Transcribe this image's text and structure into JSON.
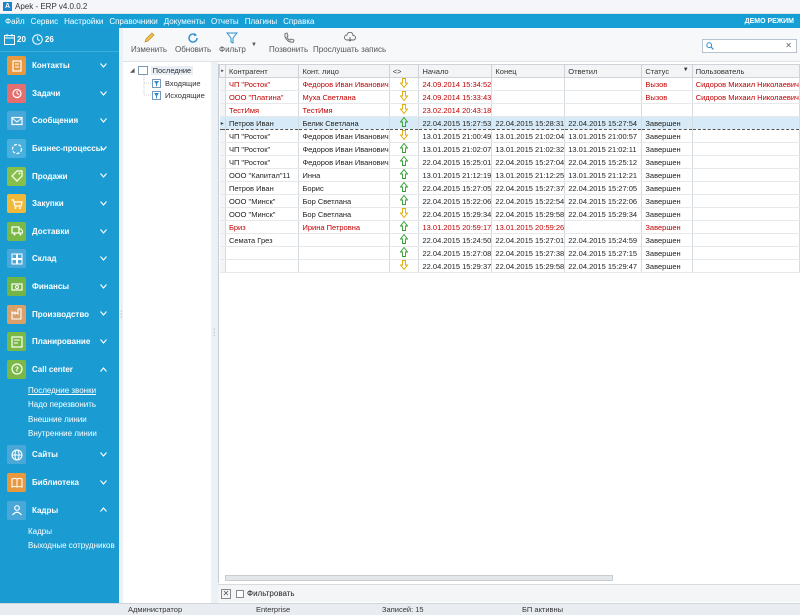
{
  "window": {
    "title": "Apek - ERP v4.0.0.2",
    "app_icon": "A"
  },
  "menu": {
    "items": [
      "Файл",
      "Сервис",
      "Настройки",
      "Справочники",
      "Документы",
      "Отчеты",
      "Плагины",
      "Справка"
    ],
    "demo_label": "ДЕМО РЕЖИМ"
  },
  "sidebar": {
    "calendar_value": "20",
    "clock_value": "26",
    "nav": [
      {
        "label": "Контакты",
        "icon": "contacts-icon",
        "color": "#e8983f",
        "expanded": false
      },
      {
        "label": "Задачи",
        "icon": "alarm-clock-icon",
        "color": "#e56f6f",
        "expanded": false
      },
      {
        "label": "Сообщения",
        "icon": "envelope-icon",
        "color": "#4aa8d8",
        "expanded": false
      },
      {
        "label": "Бизнес-процессы",
        "icon": "process-icon",
        "color": "#49b0de",
        "expanded": false
      },
      {
        "label": "Продажи",
        "icon": "tag-icon",
        "color": "#86c04a",
        "expanded": false
      },
      {
        "label": "Закупки",
        "icon": "cart-icon",
        "color": "#f0b93a",
        "expanded": false
      },
      {
        "label": "Доставки",
        "icon": "truck-icon",
        "color": "#7bb947",
        "expanded": false
      },
      {
        "label": "Склад",
        "icon": "warehouse-icon",
        "color": "#4aa8d8",
        "expanded": false
      },
      {
        "label": "Финансы",
        "icon": "money-icon",
        "color": "#73b545",
        "expanded": false
      },
      {
        "label": "Производство",
        "icon": "factory-icon",
        "color": "#d9a06a",
        "expanded": false
      },
      {
        "label": "Планирование",
        "icon": "planning-icon",
        "color": "#7bb947",
        "expanded": false
      },
      {
        "label": "Call center",
        "icon": "question-icon",
        "color": "#7bb947",
        "expanded": true,
        "subitems": [
          "Последние звонки",
          "Надо перезвонить",
          "Внешние линии",
          "Внутренние линии"
        ]
      },
      {
        "label": "Сайты",
        "icon": "globe-icon",
        "color": "#4aa8d8",
        "expanded": false
      },
      {
        "label": "Библиотека",
        "icon": "book-icon",
        "color": "#e8983f",
        "expanded": false
      },
      {
        "label": "Кадры",
        "icon": "person-icon",
        "color": "#4aa8d8",
        "expanded": true,
        "subitems": [
          "Кадры",
          "Выходные сотрудников"
        ]
      }
    ]
  },
  "toolbar": {
    "edit": "Изменить",
    "refresh": "Обновить",
    "filter": "Фильтр",
    "call": "Позвонить",
    "listen": "Прослушать запись",
    "search_placeholder": ""
  },
  "tree": {
    "root": "Последние",
    "children": [
      "Входящие",
      "Исходящие"
    ]
  },
  "grid": {
    "columns": [
      "Контрагент",
      "Конт. лицо",
      "<>",
      "Начало",
      "Конец",
      "Ответил",
      "Статус",
      "Пользователь"
    ],
    "rows": [
      {
        "contractor": "ЧП \"Росток\"",
        "contact": "Федоров Иван Иванович",
        "dir": "in",
        "start": "24.09.2014 15:34:52",
        "end": "",
        "answered": "",
        "status": "Вызов",
        "user": "Сидоров Михаил Николаевич",
        "red": true,
        "selected": false
      },
      {
        "contractor": "ООО \"Платина\"",
        "contact": "Муха Светлана",
        "dir": "in",
        "start": "24.09.2014 15:33:43",
        "end": "",
        "answered": "",
        "status": "Вызов",
        "user": "Сидоров Михаил Николаевич",
        "red": true,
        "selected": false
      },
      {
        "contractor": "ТестИмя",
        "contact": "ТестИмя",
        "dir": "in",
        "start": "23.02.2014 20:43:18",
        "end": "",
        "answered": "",
        "status": "",
        "user": "",
        "red": true,
        "selected": false
      },
      {
        "contractor": "Петров Иван",
        "contact": "Белик Светлана",
        "dir": "out",
        "start": "22.04.2015 15:27:53",
        "end": "22.04.2015 15:28:31",
        "answered": "22.04.2015 15:27:54",
        "status": "Завершен",
        "user": "",
        "red": false,
        "selected": true
      },
      {
        "contractor": "ЧП \"Росток\"",
        "contact": "Федоров Иван Иванович",
        "dir": "in",
        "start": "13.01.2015 21:00:49",
        "end": "13.01.2015 21:02:04",
        "answered": "13.01.2015 21:00:57",
        "status": "Завершен",
        "user": "",
        "red": false,
        "selected": false
      },
      {
        "contractor": "ЧП \"Росток\"",
        "contact": "Федоров Иван Иванович",
        "dir": "out",
        "start": "13.01.2015 21:02:07",
        "end": "13.01.2015 21:02:32",
        "answered": "13.01.2015 21:02:11",
        "status": "Завершен",
        "user": "",
        "red": false,
        "selected": false
      },
      {
        "contractor": "ЧП \"Росток\"",
        "contact": "Федоров Иван Иванович",
        "dir": "out",
        "start": "22.04.2015 15:25:01",
        "end": "22.04.2015 15:27:04",
        "answered": "22.04.2015 15:25:12",
        "status": "Завершен",
        "user": "",
        "red": false,
        "selected": false
      },
      {
        "contractor": "ООО \"Капитал\"11",
        "contact": "Инна",
        "dir": "out",
        "start": "13.01.2015 21:12:19",
        "end": "13.01.2015 21:12:25",
        "answered": "13.01.2015 21:12:21",
        "status": "Завершен",
        "user": "",
        "red": false,
        "selected": false
      },
      {
        "contractor": "Петров Иван",
        "contact": "Борис",
        "dir": "out",
        "start": "22.04.2015 15:27:05",
        "end": "22.04.2015 15:27:37",
        "answered": "22.04.2015 15:27:05",
        "status": "Завершен",
        "user": "",
        "red": false,
        "selected": false
      },
      {
        "contractor": "ООО \"Минск\"",
        "contact": "Бор Светлана",
        "dir": "out",
        "start": "22.04.2015 15:22:06",
        "end": "22.04.2015 15:22:54",
        "answered": "22.04.2015 15:22:06",
        "status": "Завершен",
        "user": "",
        "red": false,
        "selected": false
      },
      {
        "contractor": "ООО \"Минск\"",
        "contact": "Бор Светлана",
        "dir": "in",
        "start": "22.04.2015 15:29:34",
        "end": "22.04.2015 15:29:58",
        "answered": "22.04.2015 15:29:34",
        "status": "Завершен",
        "user": "",
        "red": false,
        "selected": false
      },
      {
        "contractor": "Бриз",
        "contact": "Ирина Петровна",
        "dir": "out",
        "start": "13.01.2015 20:59:17",
        "end": "13.01.2015 20:59:26",
        "answered": "",
        "status": "Завершен",
        "user": "",
        "red": true,
        "selected": false
      },
      {
        "contractor": "Семата Грез",
        "contact": "",
        "dir": "out",
        "start": "22.04.2015 15:24:50",
        "end": "22.04.2015 15:27:01",
        "answered": "22.04.2015 15:24:59",
        "status": "Завершен",
        "user": "",
        "red": false,
        "selected": false
      },
      {
        "contractor": "",
        "contact": "",
        "dir": "out",
        "start": "22.04.2015 15:27:08",
        "end": "22.04.2015 15:27:38",
        "answered": "22.04.2015 15:27:15",
        "status": "Завершен",
        "user": "",
        "red": false,
        "selected": false
      },
      {
        "contractor": "",
        "contact": "",
        "dir": "in",
        "start": "22.04.2015 15:29:37",
        "end": "22.04.2015 15:29:58",
        "answered": "22.04.2015 15:29:47",
        "status": "Завершен",
        "user": "",
        "red": false,
        "selected": false
      }
    ]
  },
  "filterbar": {
    "label": "Фильтровать"
  },
  "status": {
    "user": "Администратор",
    "edition": "Enterprise",
    "records": "Записей: 15",
    "bp": "БП активны"
  },
  "colors": {
    "accent": "#169fd5",
    "sidebar": "#1a9bd2",
    "red_text": "#c00000",
    "arrow_in": "#e0a800",
    "arrow_out": "#2e9e2e"
  }
}
